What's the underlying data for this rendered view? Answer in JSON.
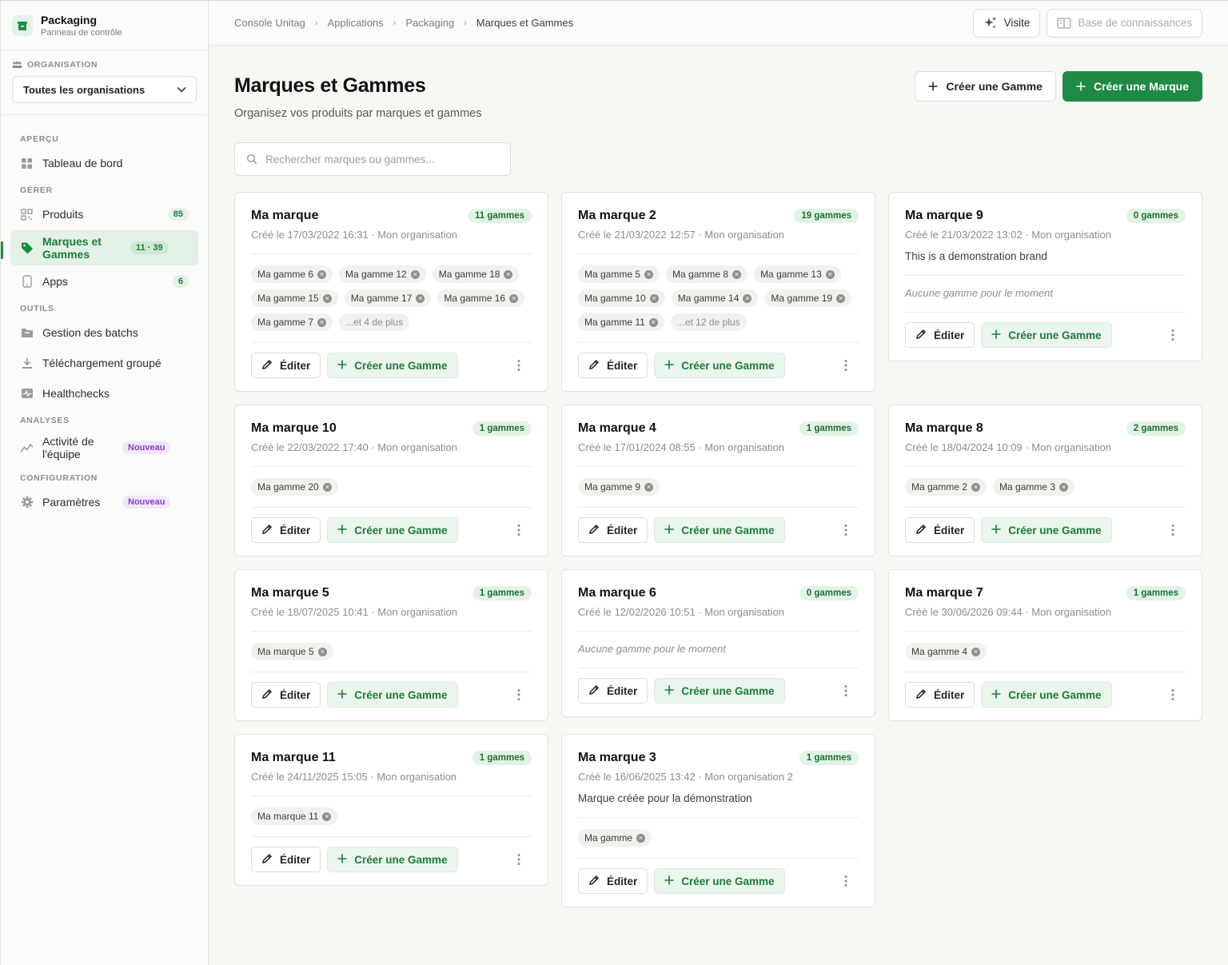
{
  "brand": {
    "title": "Packaging",
    "subtitle": "Panneau de contrôle",
    "icon": "box-icon"
  },
  "org": {
    "section": "ORGANISATION",
    "selected": "Toutes les organisations"
  },
  "nav": {
    "sections": [
      {
        "label": "APERÇU",
        "items": [
          {
            "label": "Tableau de bord",
            "icon": "dashboard-icon"
          }
        ]
      },
      {
        "label": "GÉRER",
        "items": [
          {
            "label": "Produits",
            "icon": "products-icon",
            "count": "85"
          },
          {
            "label": "Marques et Gammes",
            "icon": "tag-icon",
            "count": "11 · 39",
            "active": true
          },
          {
            "label": "Apps",
            "icon": "phone-icon",
            "count": "6"
          }
        ]
      },
      {
        "label": "OUTILS",
        "items": [
          {
            "label": "Gestion des batchs",
            "icon": "folder-icon"
          },
          {
            "label": "Téléchargement groupé",
            "icon": "download-icon"
          },
          {
            "label": "Healthchecks",
            "icon": "health-icon"
          }
        ]
      },
      {
        "label": "ANALYSES",
        "items": [
          {
            "label": "Activité de l'équipe",
            "icon": "activity-icon",
            "badge": "Nouveau"
          }
        ]
      },
      {
        "label": "CONFIGURATION",
        "items": [
          {
            "label": "Paramètres",
            "icon": "gear-icon",
            "badge": "Nouveau"
          }
        ]
      }
    ]
  },
  "breadcrumb": [
    "Console Unitag",
    "Applications",
    "Packaging",
    "Marques et Gammes"
  ],
  "topbar": {
    "tour_label": "Visite",
    "kb_label": "Base de connaissances"
  },
  "page": {
    "title": "Marques et Gammes",
    "subtitle": "Organisez vos produits par marques et gammes",
    "create_range_label": "Créer une Gamme",
    "create_brand_label": "Créer une Marque",
    "search_placeholder": "Rechercher marques ou gammes..."
  },
  "card_labels": {
    "edit": "Éditer",
    "create": "Créer une Gamme",
    "empty": "Aucune gamme pour le moment"
  },
  "brands": [
    {
      "name": "Ma marque",
      "count": "11 gammes",
      "meta": "Créé le 17/03/2022 16:31 · Mon organisation",
      "ranges": [
        "Ma gamme 6",
        "Ma gamme 12",
        "Ma gamme 18",
        "Ma gamme 15",
        "Ma gamme 17",
        "Ma gamme 16",
        "Ma gamme 7"
      ],
      "more": "...et 4 de plus"
    },
    {
      "name": "Ma marque 2",
      "count": "19 gammes",
      "meta": "Créé le 21/03/2022 12:57 · Mon organisation",
      "ranges": [
        "Ma gamme 5",
        "Ma gamme 8",
        "Ma gamme 13",
        "Ma gamme 10",
        "Ma gamme 14",
        "Ma gamme 19",
        "Ma gamme 11"
      ],
      "more": "...et 12 de plus"
    },
    {
      "name": "Ma marque 9",
      "count": "0 gammes",
      "meta": "Créé le 21/03/2022 13:02 · Mon organisation",
      "description": "This is a demonstration brand",
      "ranges": []
    },
    {
      "name": "Ma marque 10",
      "count": "1 gammes",
      "meta": "Créé le 22/03/2022 17:40 · Mon organisation",
      "ranges": [
        "Ma gamme 20"
      ]
    },
    {
      "name": "Ma marque 4",
      "count": "1 gammes",
      "meta": "Créé le 17/01/2024 08:55 · Mon organisation",
      "ranges": [
        "Ma gamme 9"
      ]
    },
    {
      "name": "Ma marque 8",
      "count": "2 gammes",
      "meta": "Créé le 18/04/2024 10:09 · Mon organisation",
      "ranges": [
        "Ma gamme 2",
        "Ma gamme 3"
      ]
    },
    {
      "name": "Ma marque 5",
      "count": "1 gammes",
      "meta": "Créé le 18/07/2025 10:41 · Mon organisation",
      "ranges": [
        "Ma marque 5"
      ]
    },
    {
      "name": "Ma marque 6",
      "count": "0 gammes",
      "meta": "Créé le 12/02/2026 10:51 · Mon organisation",
      "ranges": []
    },
    {
      "name": "Ma marque 7",
      "count": "1 gammes",
      "meta": "Créé le 30/06/2026 09:44 · Mon organisation",
      "ranges": [
        "Ma gamme 4"
      ]
    },
    {
      "name": "Ma marque 11",
      "count": "1 gammes",
      "meta": "Créé le 24/11/2025 15:05 · Mon organisation",
      "ranges": [
        "Ma marque 11"
      ]
    },
    {
      "name": "Ma marque 3",
      "count": "1 gammes",
      "meta": "Créé le 16/06/2025 13:42 · Mon organisation 2",
      "description": "Marque créée pour la démonstration",
      "ranges": [
        "Ma gamme"
      ]
    }
  ],
  "colors": {
    "accent": "#1e8a45",
    "accent_soft": "#e2f2e5",
    "new_badge": "#8b3fc7"
  }
}
